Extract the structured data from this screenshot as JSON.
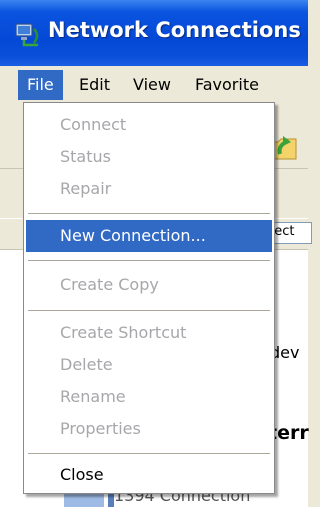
{
  "window": {
    "title": "Network Connections",
    "icon": "network-connections-icon"
  },
  "menubar": {
    "items": [
      {
        "label": "File",
        "active": true
      },
      {
        "label": "Edit",
        "active": false
      },
      {
        "label": "View",
        "active": false
      },
      {
        "label": "Favorite",
        "active": false
      }
    ]
  },
  "file_menu": {
    "groups": [
      [
        {
          "label": "Connect",
          "enabled": false
        },
        {
          "label": "Status",
          "enabled": false
        },
        {
          "label": "Repair",
          "enabled": false
        }
      ],
      [
        {
          "label": "New Connection...",
          "enabled": true,
          "highlighted": true
        }
      ],
      [
        {
          "label": "Create Copy",
          "enabled": false
        }
      ],
      [
        {
          "label": "Create Shortcut",
          "enabled": false
        },
        {
          "label": "Delete",
          "enabled": false
        },
        {
          "label": "Rename",
          "enabled": false
        },
        {
          "label": "Properties",
          "enabled": false
        }
      ],
      [
        {
          "label": "Close",
          "enabled": true
        }
      ]
    ]
  },
  "background": {
    "address_text": "nect",
    "text_dev": "dev",
    "text_terr": "terr",
    "text_conn": "1394 Connection"
  },
  "colors": {
    "titlebar": "#0449d6",
    "highlight": "#316ac5",
    "menu_bg": "#ece9d8",
    "disabled_text": "#a7a6aa"
  }
}
